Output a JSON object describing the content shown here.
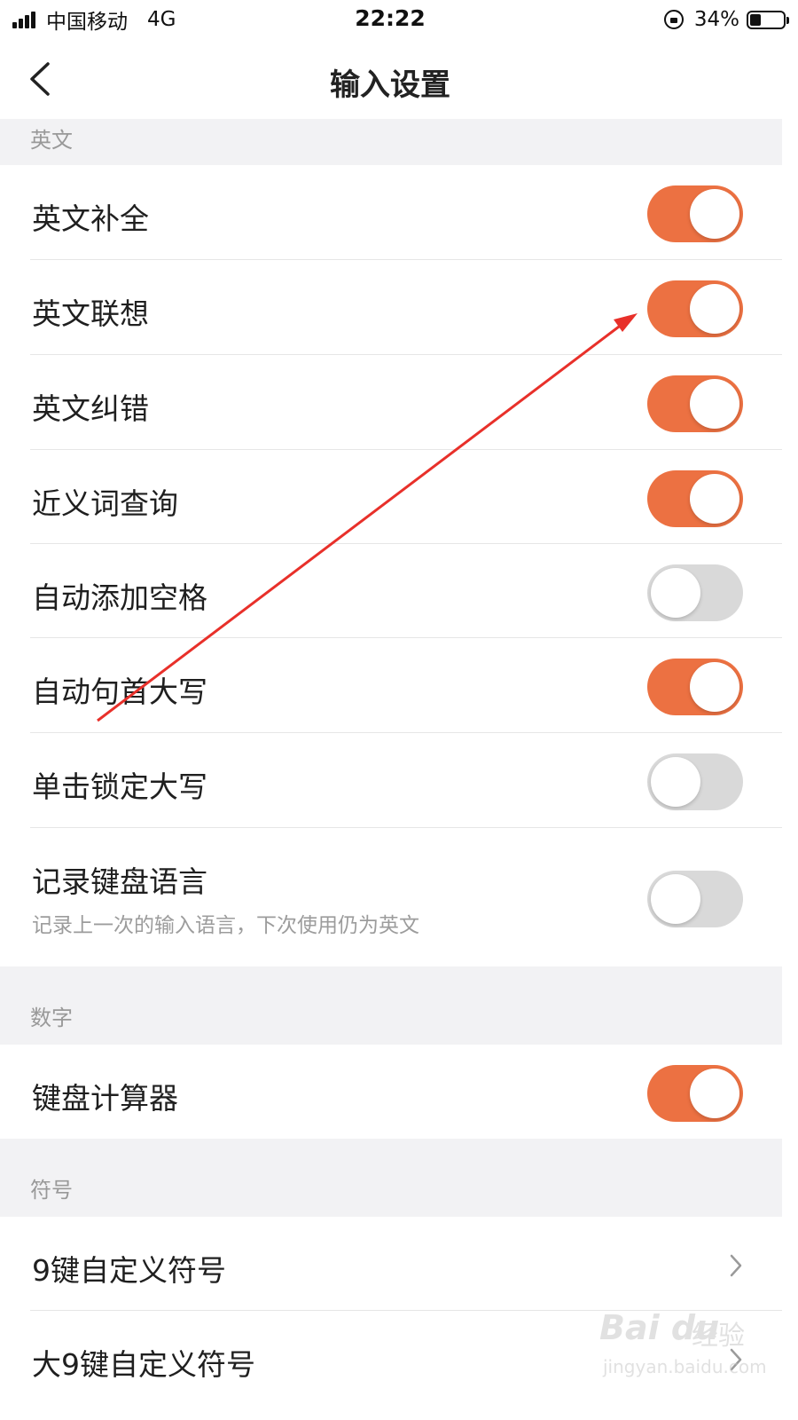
{
  "status_bar": {
    "carrier": "中国移动",
    "network": "4G",
    "time": "22:22",
    "battery_percent": "34%",
    "battery_level": 0.34
  },
  "nav": {
    "title": "输入设置"
  },
  "sections": {
    "english": {
      "header": "英文",
      "rows": [
        {
          "label": "英文补全",
          "enabled": true
        },
        {
          "label": "英文联想",
          "enabled": true
        },
        {
          "label": "英文纠错",
          "enabled": true
        },
        {
          "label": "近义词查询",
          "enabled": true
        },
        {
          "label": "自动添加空格",
          "enabled": false
        },
        {
          "label": "自动句首大写",
          "enabled": true
        },
        {
          "label": "单击锁定大写",
          "enabled": false
        },
        {
          "label": "记录键盘语言",
          "sublabel": "记录上一次的输入语言，下次使用仍为英文",
          "enabled": false
        }
      ]
    },
    "numbers": {
      "header": "数字",
      "rows": [
        {
          "label": "键盘计算器",
          "enabled": true
        }
      ]
    },
    "symbols": {
      "header": "符号",
      "rows": [
        {
          "label": "9键自定义符号"
        },
        {
          "label": "大9键自定义符号"
        }
      ]
    }
  },
  "watermark": {
    "logo": "Bai du",
    "text": "经验",
    "url": "jingyan.baidu.com"
  },
  "colors": {
    "accent": "#ec7142",
    "toggle_off": "#d9d9d9",
    "section_bg": "#f2f2f4",
    "annotation": "#e8302a"
  }
}
